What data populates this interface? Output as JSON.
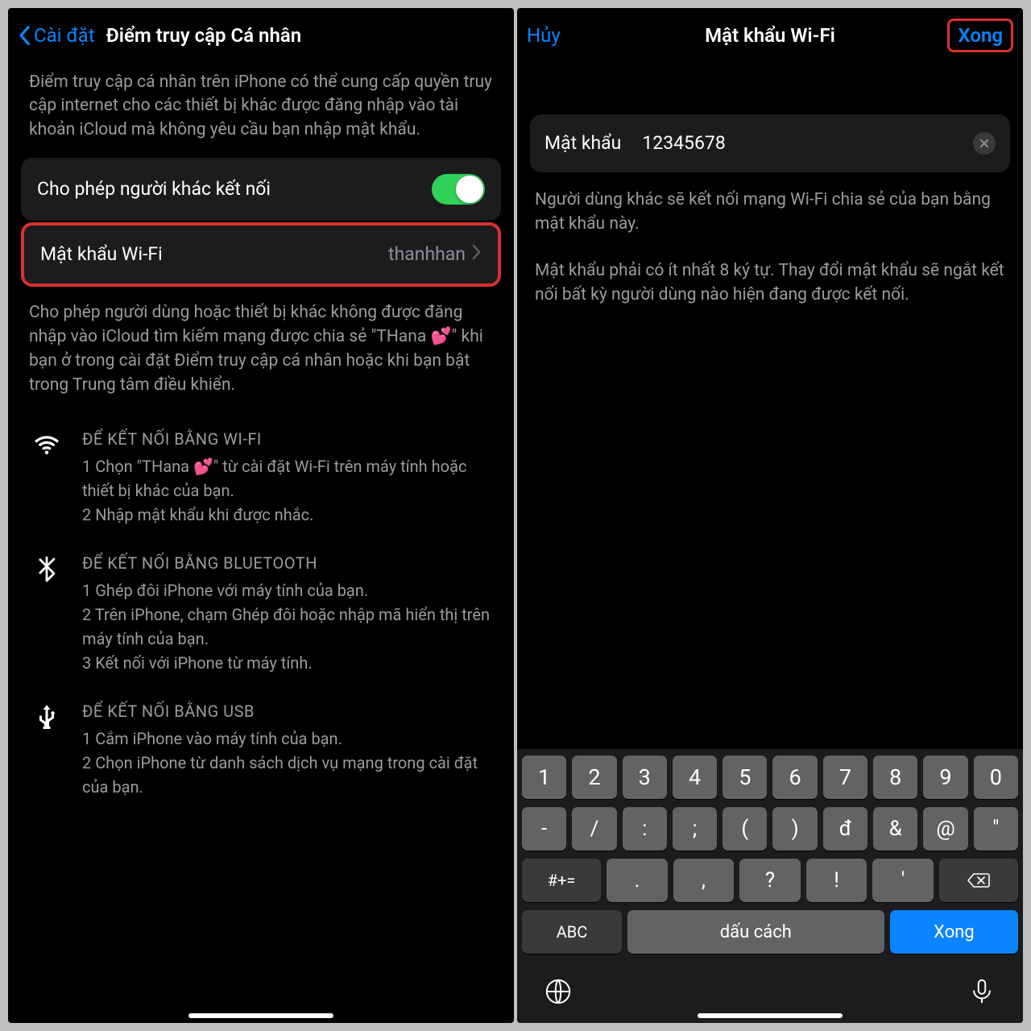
{
  "left": {
    "nav": {
      "back": "Cài đặt",
      "title": "Điểm truy cập Cá nhân"
    },
    "intro": "Điểm truy cập cá nhân trên iPhone có thể cung cấp quyền truy cập internet cho các thiết bị khác được đăng nhập vào tài khoản iCloud mà không yêu cầu bạn nhập mật khẩu.",
    "allow_label": "Cho phép người khác kết nối",
    "wifi_pw_label": "Mật khẩu Wi-Fi",
    "wifi_pw_value": "thanhhan",
    "footer": "Cho phép người dùng hoặc thiết bị khác không được đăng nhập vào iCloud tìm kiếm mạng được chia sẻ \"THana 💕\" khi bạn ở trong cài đặt Điểm truy cập cá nhân hoặc khi bạn bật trong Trung tâm điều khiển.",
    "wifi": {
      "title": "ĐỂ KẾT NỐI BẰNG WI-FI",
      "l1": "1 Chọn \"THana 💕\" từ cài đặt Wi-Fi trên máy tính hoặc thiết bị khác của bạn.",
      "l2": "2 Nhập mật khẩu khi được nhắc."
    },
    "bt": {
      "title": "ĐỂ KẾT NỐI BẰNG BLUETOOTH",
      "l1": "1 Ghép đôi iPhone với máy tính của bạn.",
      "l2": "2 Trên iPhone, chạm Ghép đôi hoặc nhập mã hiển thị trên máy tính của bạn.",
      "l3": "3 Kết nối với iPhone từ máy tính."
    },
    "usb": {
      "title": "ĐỂ KẾT NỐI BẰNG USB",
      "l1": "1 Cắm iPhone vào máy tính của bạn.",
      "l2": "2 Chọn iPhone từ danh sách dịch vụ mạng trong cài đặt của bạn."
    }
  },
  "right": {
    "nav": {
      "cancel": "Hủy",
      "title": "Mật khẩu Wi-Fi",
      "done": "Xong"
    },
    "field_label": "Mật khẩu",
    "field_value": "12345678",
    "desc1": "Người dùng khác sẽ kết nối mạng Wi-Fi chia sẻ của bạn bằng mật khẩu này.",
    "desc2": "Mật khẩu phải có ít nhất 8 ký tự. Thay đổi mật khẩu sẽ ngắt kết nối bất kỳ người dùng nào hiện đang được kết nối.",
    "keys": {
      "r1": [
        "1",
        "2",
        "3",
        "4",
        "5",
        "6",
        "7",
        "8",
        "9",
        "0"
      ],
      "r2": [
        "-",
        "/",
        ":",
        ";",
        "(",
        ")",
        "đ",
        "&",
        "@",
        "\""
      ],
      "r3_shift": "#+=",
      "r3": [
        ".",
        ",",
        "?",
        "!",
        "'"
      ],
      "abc": "ABC",
      "space": "dấu cách",
      "done": "Xong"
    }
  }
}
